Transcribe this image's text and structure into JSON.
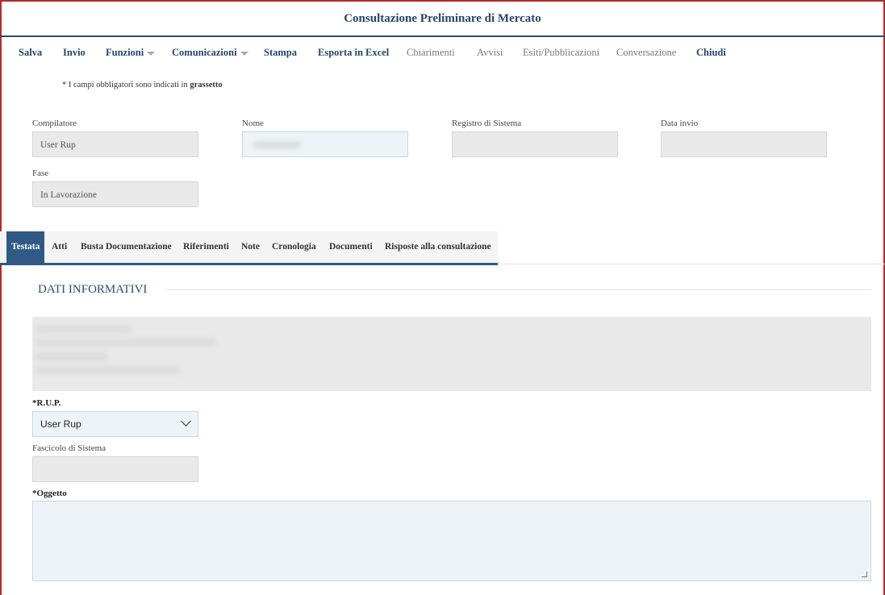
{
  "window": {
    "title": "Consultazione Preliminare di Mercato"
  },
  "toolbar": {
    "items": [
      {
        "label": "Salva",
        "style": "bold"
      },
      {
        "label": "Invio",
        "style": "bold"
      },
      {
        "label": "Funzioni",
        "style": "bold",
        "dropdown": true
      },
      {
        "label": "Comunicazioni",
        "style": "bold",
        "dropdown": true
      },
      {
        "label": "Stampa",
        "style": "bold"
      },
      {
        "label": "Esporta in Excel",
        "style": "bold"
      },
      {
        "label": "Chiarimenti",
        "style": "light"
      },
      {
        "label": "Avvisi",
        "style": "light"
      },
      {
        "label": "Esiti/Pubblicazioni",
        "style": "light"
      },
      {
        "label": "Conversazione",
        "style": "light"
      },
      {
        "label": "Chiudi",
        "style": "bold"
      }
    ]
  },
  "note": {
    "prefix": "* I campi obbligatori sono indicati in",
    "bold_word": "grassetto"
  },
  "header_fields": {
    "compilatore": {
      "label": "Compilatore",
      "value": "User Rup"
    },
    "nome": {
      "label": "Nome",
      "value": ""
    },
    "registro": {
      "label": "Registro di Sistema",
      "value": ""
    },
    "data_invio": {
      "label": "Data invio",
      "value": ""
    },
    "fase": {
      "label": "Fase",
      "value": "In Lavorazione"
    }
  },
  "tabs": [
    {
      "label": "Testata",
      "active": true
    },
    {
      "label": "Atti"
    },
    {
      "label": "Busta Documentazione"
    },
    {
      "label": "Riferimenti"
    },
    {
      "label": "Note"
    },
    {
      "label": "Cronologia"
    },
    {
      "label": "Documenti"
    },
    {
      "label": "Risposte alla consultazione"
    }
  ],
  "section": {
    "title": "DATI INFORMATIVI"
  },
  "form": {
    "rup": {
      "label": "*R.U.P.",
      "value": "User Rup"
    },
    "fascicolo": {
      "label": "Fascicolo di Sistema",
      "value": ""
    },
    "oggetto": {
      "label": "*Oggetto",
      "value": ""
    }
  },
  "colors": {
    "title": "#24466b",
    "tab_active": "#2f5a86",
    "frame": "#b52a2a"
  }
}
